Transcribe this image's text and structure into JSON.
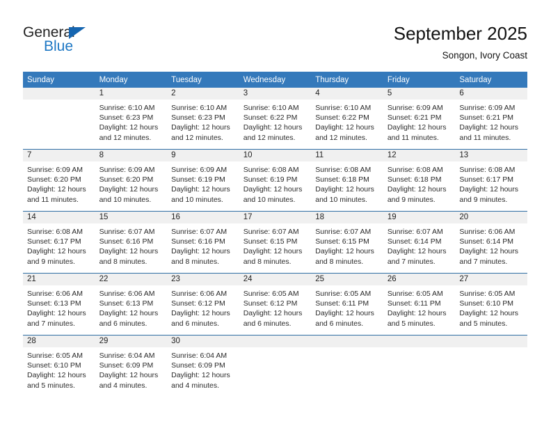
{
  "brand": {
    "name_top": "General",
    "name_bottom": "Blue",
    "accent_color": "#1d77c4",
    "triangle_color": "#1565b0"
  },
  "header": {
    "title": "September 2025",
    "subtitle": "Songon, Ivory Coast"
  },
  "theme": {
    "header_row_bg": "#3479bb",
    "daynum_bg": "#f0f0f0",
    "row_divider": "#2e6da4",
    "page_bg": "#ffffff",
    "text": "#2a2a2a"
  },
  "calendar": {
    "day_headers": [
      "Sunday",
      "Monday",
      "Tuesday",
      "Wednesday",
      "Thursday",
      "Friday",
      "Saturday"
    ],
    "weeks": [
      [
        {
          "day": "",
          "lines": []
        },
        {
          "day": "1",
          "lines": [
            "Sunrise: 6:10 AM",
            "Sunset: 6:23 PM",
            "Daylight: 12 hours",
            "and 12 minutes."
          ]
        },
        {
          "day": "2",
          "lines": [
            "Sunrise: 6:10 AM",
            "Sunset: 6:23 PM",
            "Daylight: 12 hours",
            "and 12 minutes."
          ]
        },
        {
          "day": "3",
          "lines": [
            "Sunrise: 6:10 AM",
            "Sunset: 6:22 PM",
            "Daylight: 12 hours",
            "and 12 minutes."
          ]
        },
        {
          "day": "4",
          "lines": [
            "Sunrise: 6:10 AM",
            "Sunset: 6:22 PM",
            "Daylight: 12 hours",
            "and 12 minutes."
          ]
        },
        {
          "day": "5",
          "lines": [
            "Sunrise: 6:09 AM",
            "Sunset: 6:21 PM",
            "Daylight: 12 hours",
            "and 11 minutes."
          ]
        },
        {
          "day": "6",
          "lines": [
            "Sunrise: 6:09 AM",
            "Sunset: 6:21 PM",
            "Daylight: 12 hours",
            "and 11 minutes."
          ]
        }
      ],
      [
        {
          "day": "7",
          "lines": [
            "Sunrise: 6:09 AM",
            "Sunset: 6:20 PM",
            "Daylight: 12 hours",
            "and 11 minutes."
          ]
        },
        {
          "day": "8",
          "lines": [
            "Sunrise: 6:09 AM",
            "Sunset: 6:20 PM",
            "Daylight: 12 hours",
            "and 10 minutes."
          ]
        },
        {
          "day": "9",
          "lines": [
            "Sunrise: 6:09 AM",
            "Sunset: 6:19 PM",
            "Daylight: 12 hours",
            "and 10 minutes."
          ]
        },
        {
          "day": "10",
          "lines": [
            "Sunrise: 6:08 AM",
            "Sunset: 6:19 PM",
            "Daylight: 12 hours",
            "and 10 minutes."
          ]
        },
        {
          "day": "11",
          "lines": [
            "Sunrise: 6:08 AM",
            "Sunset: 6:18 PM",
            "Daylight: 12 hours",
            "and 10 minutes."
          ]
        },
        {
          "day": "12",
          "lines": [
            "Sunrise: 6:08 AM",
            "Sunset: 6:18 PM",
            "Daylight: 12 hours",
            "and 9 minutes."
          ]
        },
        {
          "day": "13",
          "lines": [
            "Sunrise: 6:08 AM",
            "Sunset: 6:17 PM",
            "Daylight: 12 hours",
            "and 9 minutes."
          ]
        }
      ],
      [
        {
          "day": "14",
          "lines": [
            "Sunrise: 6:08 AM",
            "Sunset: 6:17 PM",
            "Daylight: 12 hours",
            "and 9 minutes."
          ]
        },
        {
          "day": "15",
          "lines": [
            "Sunrise: 6:07 AM",
            "Sunset: 6:16 PM",
            "Daylight: 12 hours",
            "and 8 minutes."
          ]
        },
        {
          "day": "16",
          "lines": [
            "Sunrise: 6:07 AM",
            "Sunset: 6:16 PM",
            "Daylight: 12 hours",
            "and 8 minutes."
          ]
        },
        {
          "day": "17",
          "lines": [
            "Sunrise: 6:07 AM",
            "Sunset: 6:15 PM",
            "Daylight: 12 hours",
            "and 8 minutes."
          ]
        },
        {
          "day": "18",
          "lines": [
            "Sunrise: 6:07 AM",
            "Sunset: 6:15 PM",
            "Daylight: 12 hours",
            "and 8 minutes."
          ]
        },
        {
          "day": "19",
          "lines": [
            "Sunrise: 6:07 AM",
            "Sunset: 6:14 PM",
            "Daylight: 12 hours",
            "and 7 minutes."
          ]
        },
        {
          "day": "20",
          "lines": [
            "Sunrise: 6:06 AM",
            "Sunset: 6:14 PM",
            "Daylight: 12 hours",
            "and 7 minutes."
          ]
        }
      ],
      [
        {
          "day": "21",
          "lines": [
            "Sunrise: 6:06 AM",
            "Sunset: 6:13 PM",
            "Daylight: 12 hours",
            "and 7 minutes."
          ]
        },
        {
          "day": "22",
          "lines": [
            "Sunrise: 6:06 AM",
            "Sunset: 6:13 PM",
            "Daylight: 12 hours",
            "and 6 minutes."
          ]
        },
        {
          "day": "23",
          "lines": [
            "Sunrise: 6:06 AM",
            "Sunset: 6:12 PM",
            "Daylight: 12 hours",
            "and 6 minutes."
          ]
        },
        {
          "day": "24",
          "lines": [
            "Sunrise: 6:05 AM",
            "Sunset: 6:12 PM",
            "Daylight: 12 hours",
            "and 6 minutes."
          ]
        },
        {
          "day": "25",
          "lines": [
            "Sunrise: 6:05 AM",
            "Sunset: 6:11 PM",
            "Daylight: 12 hours",
            "and 6 minutes."
          ]
        },
        {
          "day": "26",
          "lines": [
            "Sunrise: 6:05 AM",
            "Sunset: 6:11 PM",
            "Daylight: 12 hours",
            "and 5 minutes."
          ]
        },
        {
          "day": "27",
          "lines": [
            "Sunrise: 6:05 AM",
            "Sunset: 6:10 PM",
            "Daylight: 12 hours",
            "and 5 minutes."
          ]
        }
      ],
      [
        {
          "day": "28",
          "lines": [
            "Sunrise: 6:05 AM",
            "Sunset: 6:10 PM",
            "Daylight: 12 hours",
            "and 5 minutes."
          ]
        },
        {
          "day": "29",
          "lines": [
            "Sunrise: 6:04 AM",
            "Sunset: 6:09 PM",
            "Daylight: 12 hours",
            "and 4 minutes."
          ]
        },
        {
          "day": "30",
          "lines": [
            "Sunrise: 6:04 AM",
            "Sunset: 6:09 PM",
            "Daylight: 12 hours",
            "and 4 minutes."
          ]
        },
        {
          "day": "",
          "lines": []
        },
        {
          "day": "",
          "lines": []
        },
        {
          "day": "",
          "lines": []
        },
        {
          "day": "",
          "lines": []
        }
      ]
    ]
  }
}
